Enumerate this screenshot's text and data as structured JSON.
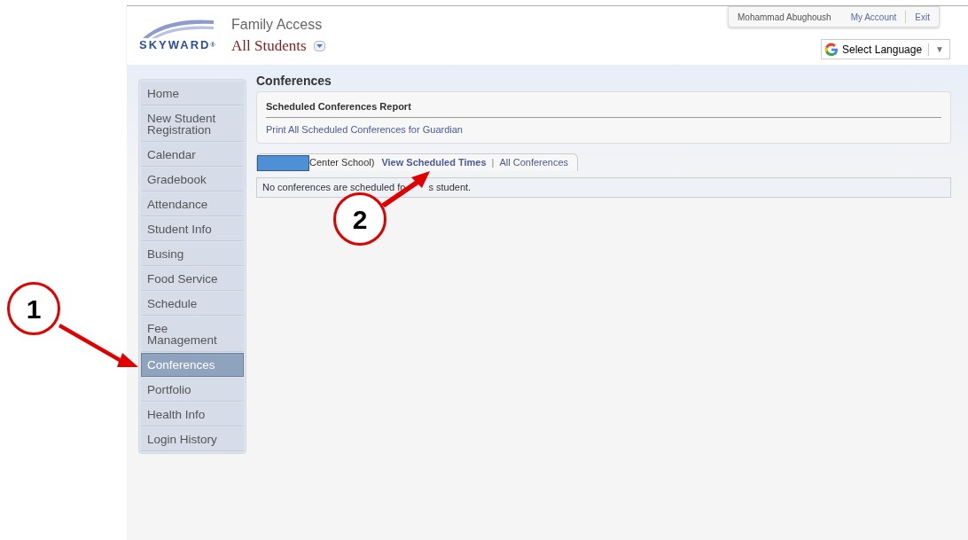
{
  "header": {
    "logo_text": "SKYWARD",
    "logo_mark": "®",
    "app_title": "Family Access",
    "student_selector": "All Students",
    "user_name": "Mohammad Abughoush",
    "links": [
      "My Account",
      "Exit"
    ],
    "language_selector": "Select Language",
    "language_caret": "▼"
  },
  "sidebar": {
    "items": [
      {
        "label": "Home",
        "selected": false
      },
      {
        "label": "New Student Registration",
        "selected": false
      },
      {
        "label": "Calendar",
        "selected": false
      },
      {
        "label": "Gradebook",
        "selected": false
      },
      {
        "label": "Attendance",
        "selected": false
      },
      {
        "label": "Student Info",
        "selected": false
      },
      {
        "label": "Busing",
        "selected": false
      },
      {
        "label": "Food Service",
        "selected": false
      },
      {
        "label": "Schedule",
        "selected": false
      },
      {
        "label": "Fee Management",
        "selected": false
      },
      {
        "label": "Conferences",
        "selected": true
      },
      {
        "label": "Portfolio",
        "selected": false
      },
      {
        "label": "Health Info",
        "selected": false
      },
      {
        "label": "Login History",
        "selected": false
      }
    ]
  },
  "page_title": "Conferences",
  "report": {
    "title": "Scheduled Conferences Report",
    "link": "Print All Scheduled Conferences for Guardian"
  },
  "tab": {
    "school": "Center School)",
    "links": [
      "View Scheduled Times",
      "All Conferences"
    ],
    "separator": "|"
  },
  "message": {
    "before": "No conferences are scheduled fo",
    "after": "s student."
  },
  "annotations": [
    {
      "number": "1"
    },
    {
      "number": "2"
    }
  ]
}
